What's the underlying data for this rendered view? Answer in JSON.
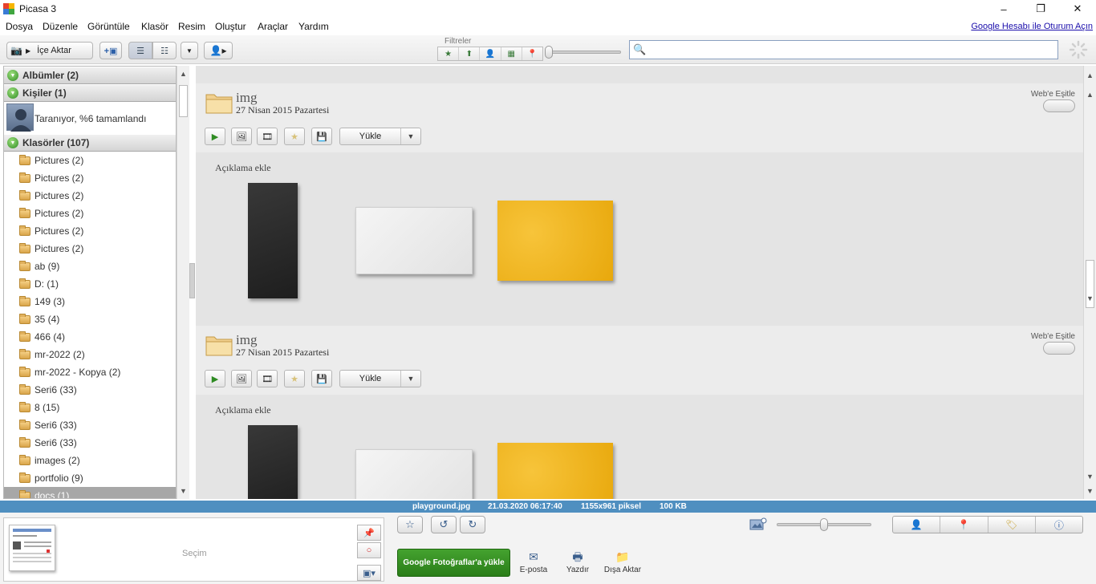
{
  "app": {
    "title": "Picasa 3"
  },
  "window": {
    "minimize": "–",
    "restore": "❐",
    "close": "✕"
  },
  "menu": {
    "items": [
      "Dosya",
      "Düzenle",
      "Görüntüle",
      "Klasör",
      "Resim",
      "Oluştur",
      "Araçlar",
      "Yardım"
    ],
    "account_link": "Google Hesabı ile Oturum Açın"
  },
  "toolbar": {
    "import_label": "İçe Aktar",
    "filters_label": "Filtreler",
    "search": {
      "value": "",
      "placeholder": ""
    }
  },
  "left_panel": {
    "albums_header": "Albümler (2)",
    "people_header": "Kişiler (1)",
    "people_status": "Taranıyor, %6 tamamlandı",
    "folders_header": "Klasörler (107)",
    "folders": [
      "Pictures (2)",
      "Pictures (2)",
      "Pictures (2)",
      "Pictures (2)",
      "Pictures (2)",
      "Pictures (2)",
      "ab (9)",
      "D: (1)",
      "149 (3)",
      "35 (4)",
      "466 (4)",
      "mr-2022 (2)",
      "mr-2022 - Kopya (2)",
      "Seri6 (33)",
      "8 (15)",
      "Seri6 (33)",
      "Seri6 (33)",
      "images (2)",
      "portfolio (9)",
      "docs (1)"
    ],
    "selected_folder_index": 19
  },
  "albums": [
    {
      "name": "img",
      "date": "27 Nisan 2015 Pazartesi",
      "sync_label": "Web'e Eşitle",
      "upload_label": "Yükle",
      "description": "Açıklama ekle"
    },
    {
      "name": "img",
      "date": "27 Nisan 2015 Pazartesi",
      "sync_label": "Web'e Eşitle",
      "upload_label": "Yükle",
      "description": "Açıklama ekle"
    }
  ],
  "status": {
    "filename": "playground.jpg",
    "datetime": "21.03.2020 06:17:40",
    "dimensions": "1155x961 piksel",
    "filesize": "100 KB"
  },
  "tray": {
    "selection_label": "Seçim",
    "upload_button": "Google Fotoğraflar'a yükle",
    "email_label": "E-posta",
    "print_label": "Yazdır",
    "export_label": "Dışa Aktar",
    "zoom_level": 0.5
  }
}
